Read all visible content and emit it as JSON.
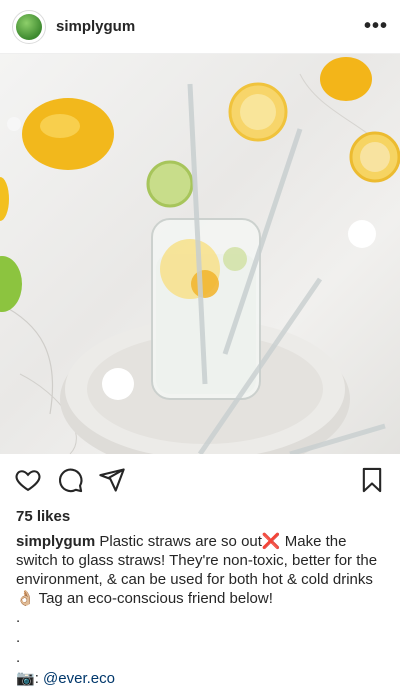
{
  "header": {
    "username": "simplygum",
    "more_label": "•••"
  },
  "photo": {
    "subject": "glass of lemon water with glass straws on marble tray"
  },
  "post": {
    "likes": "75 likes",
    "caption_user": "simplygum",
    "caption_part1": " Plastic straws are so out",
    "emoji_x": "❌",
    "caption_part2": " Make the switch to glass straws! They're non-toxic, better for the environment, & can be used for both hot & cold drinks",
    "emoji_ok": "👌🏼",
    "caption_part3": " Tag an eco-conscious friend below!",
    "dots": [
      ".",
      ".",
      "."
    ],
    "camera_emoji": "📷",
    "credit_sep": ": ",
    "credit_handle": "@ever.eco"
  },
  "colors": {
    "link": "#00376b",
    "text": "#262626"
  }
}
